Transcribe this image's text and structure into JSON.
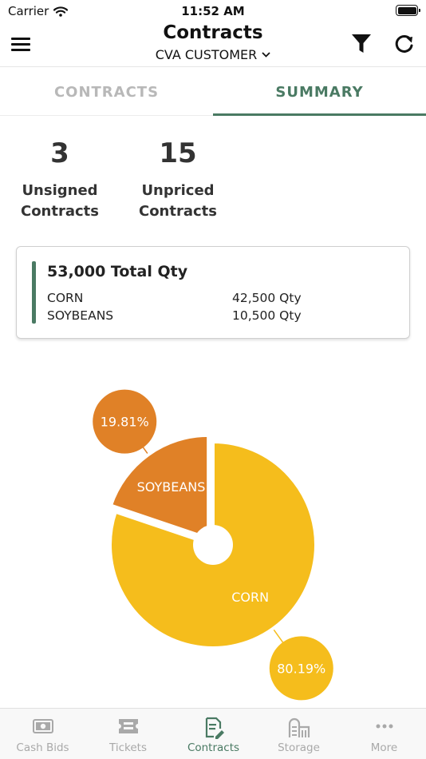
{
  "status": {
    "carrier": "Carrier",
    "time": "11:52 AM"
  },
  "nav": {
    "title": "Contracts",
    "customer": "CVA CUSTOMER",
    "icons": [
      "menu-icon",
      "filter-icon",
      "refresh-icon",
      "chevron-down-icon"
    ]
  },
  "tabs": [
    {
      "label": "CONTRACTS",
      "active": false
    },
    {
      "label": "SUMMARY",
      "active": true
    }
  ],
  "stats": {
    "unsigned": {
      "value": "3",
      "label_line1": "Unsigned",
      "label_line2": "Contracts"
    },
    "unpriced": {
      "value": "15",
      "label_line1": "Unpriced",
      "label_line2": "Contracts"
    }
  },
  "qty_card": {
    "total": "53,000 Total Qty",
    "rows": [
      {
        "name": "CORN",
        "value": "42,500 Qty"
      },
      {
        "name": "SOYBEANS",
        "value": "10,500 Qty"
      }
    ]
  },
  "chart_data": {
    "type": "pie",
    "slices": [
      {
        "label": "SOYBEANS",
        "value": 10500,
        "percent_label": "19.81%",
        "color": "#e08127"
      },
      {
        "label": "CORN",
        "value": 42500,
        "percent_label": "80.19%",
        "color": "#f5bd1c"
      }
    ]
  },
  "colors": {
    "accent": "#4a7a63",
    "corn": "#f5bd1c",
    "soybeans": "#e08127",
    "inactive": "#a9a9a9"
  },
  "tab_bar": [
    {
      "label": "Cash Bids",
      "icon": "cash-icon",
      "active": false
    },
    {
      "label": "Tickets",
      "icon": "ticket-icon",
      "active": false
    },
    {
      "label": "Contracts",
      "icon": "contract-edit-icon",
      "active": true
    },
    {
      "label": "Storage",
      "icon": "storage-silo-icon",
      "active": false
    },
    {
      "label": "More",
      "icon": "more-dots-icon",
      "active": false
    }
  ]
}
